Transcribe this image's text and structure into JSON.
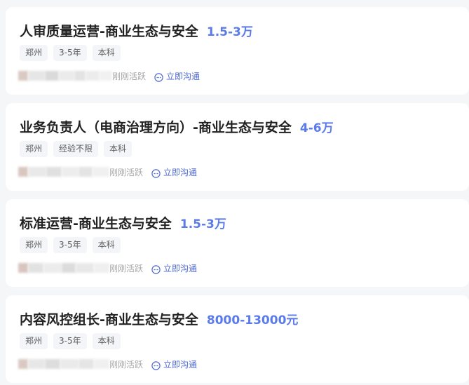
{
  "jobs": [
    {
      "title": "人审质量运营-商业生态与安全",
      "salary": "1.5-3万",
      "tags": [
        "郑州",
        "3-5年",
        "本科"
      ],
      "active_status": "刚刚活跃",
      "chat_label": "立即沟通"
    },
    {
      "title": "业务负责人（电商治理方向）-商业生态与安全",
      "salary": "4-6万",
      "tags": [
        "郑州",
        "经验不限",
        "本科"
      ],
      "active_status": "刚刚活跃",
      "chat_label": "立即沟通"
    },
    {
      "title": "标准运营-商业生态与安全",
      "salary": "1.5-3万",
      "tags": [
        "郑州",
        "3-5年",
        "本科"
      ],
      "active_status": "刚刚活跃",
      "chat_label": "立即沟通"
    },
    {
      "title": "内容风控组长-商业生态与安全",
      "salary": "8000-13000元",
      "tags": [
        "郑州",
        "3-5年",
        "本科"
      ],
      "active_status": "刚刚活跃",
      "chat_label": "立即沟通"
    }
  ],
  "colors": {
    "salary": "#5b7bea",
    "link": "#4f6ad6",
    "title": "#222222",
    "tag_bg": "#f3f5f8",
    "page_bg": "#f5f6f8"
  },
  "icons": {
    "chat": "chat-bubble-icon"
  }
}
